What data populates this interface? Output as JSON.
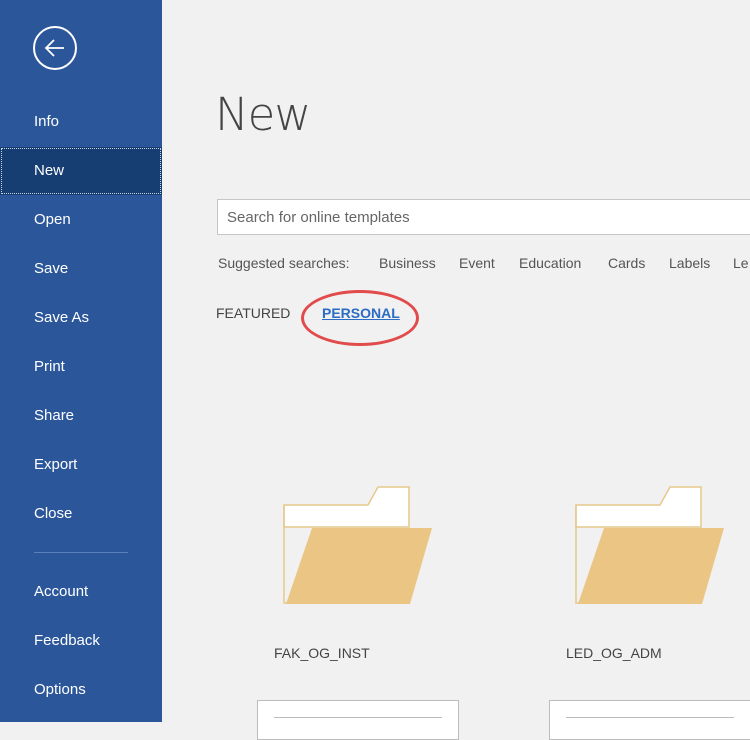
{
  "sidebar": {
    "back_label": "Back",
    "items": [
      {
        "label": "Info"
      },
      {
        "label": "New"
      },
      {
        "label": "Open"
      },
      {
        "label": "Save"
      },
      {
        "label": "Save As"
      },
      {
        "label": "Print"
      },
      {
        "label": "Share"
      },
      {
        "label": "Export"
      },
      {
        "label": "Close"
      },
      {
        "label": "Account"
      },
      {
        "label": "Feedback"
      },
      {
        "label": "Options"
      }
    ],
    "selected": "New",
    "colors": {
      "background": "#2b579a",
      "selected": "#173e72"
    }
  },
  "main": {
    "title": "New",
    "search": {
      "placeholder": "Search for online templates",
      "value": ""
    },
    "suggested": {
      "label": "Suggested searches:",
      "items": [
        "Business",
        "Event",
        "Education",
        "Cards",
        "Labels",
        "Le"
      ]
    },
    "tabs": [
      {
        "label": "FEATURED",
        "active": false
      },
      {
        "label": "PERSONAL",
        "active": true
      }
    ],
    "folders": [
      {
        "name": "FAK_OG_INST",
        "icon": "folder-icon"
      },
      {
        "name": "LED_OG_ADM",
        "icon": "folder-icon"
      }
    ],
    "accent_color": "#2b6cc4",
    "highlight_color": "#e24b4b"
  }
}
